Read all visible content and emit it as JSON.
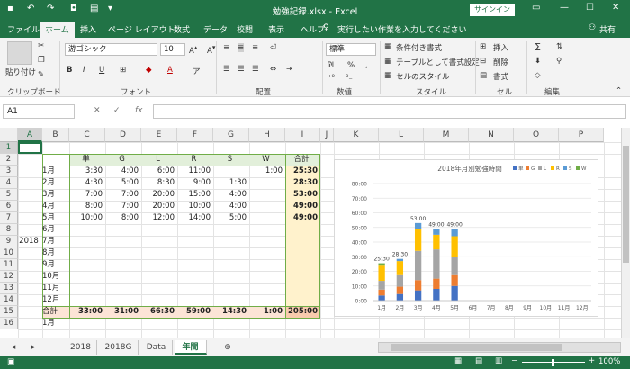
{
  "title": "勉強記録.xlsx - Excel",
  "signin": "サインイン",
  "tabs": [
    "ファイル",
    "ホーム",
    "挿入",
    "ページ レイアウト",
    "数式",
    "データ",
    "校閲",
    "表示",
    "ヘルプ"
  ],
  "tell_me": "実行したい作業を入力してください",
  "share": "共有",
  "ribbon": {
    "paste": "貼り付け",
    "font_name": "游ゴシック",
    "font_size": "10",
    "number_format": "標準",
    "cond_format": "条件付き書式",
    "table_format": "テーブルとして書式設定",
    "cell_styles": "セルのスタイル",
    "insert": "挿入",
    "delete": "削除",
    "format": "書式",
    "groups": [
      "クリップボード",
      "フォント",
      "配置",
      "数値",
      "スタイル",
      "セル",
      "編集"
    ]
  },
  "name_box": "A1",
  "columns": [
    "A",
    "B",
    "C",
    "D",
    "E",
    "F",
    "G",
    "H",
    "I",
    "J",
    "K",
    "L",
    "M",
    "N",
    "O",
    "P"
  ],
  "rows": [
    "1",
    "2",
    "3",
    "4",
    "5",
    "6",
    "7",
    "8",
    "9",
    "10",
    "11",
    "12",
    "13",
    "14",
    "15",
    "16"
  ],
  "table": {
    "headers": [
      "単",
      "G",
      "L",
      "R",
      "S",
      "W",
      "合計"
    ],
    "year": "2018",
    "months": [
      "1月",
      "2月",
      "3月",
      "4月",
      "5月",
      "6月",
      "7月",
      "8月",
      "9月",
      "10月",
      "11月",
      "12月"
    ],
    "data": [
      [
        "3:30",
        "4:00",
        "6:00",
        "11:00",
        "",
        "1:00",
        "25:30"
      ],
      [
        "4:30",
        "5:00",
        "8:30",
        "9:00",
        "1:30",
        "",
        "28:30"
      ],
      [
        "7:00",
        "7:00",
        "20:00",
        "15:00",
        "4:00",
        "",
        "53:00"
      ],
      [
        "8:00",
        "7:00",
        "20:00",
        "10:00",
        "4:00",
        "",
        "49:00"
      ],
      [
        "10:00",
        "8:00",
        "12:00",
        "14:00",
        "5:00",
        "",
        "49:00"
      ]
    ],
    "total_label": "合計",
    "totals": [
      "33:00",
      "31:00",
      "66:30",
      "59:00",
      "14:30",
      "1:00",
      "205:00"
    ],
    "row16": "1月"
  },
  "chart_data": {
    "type": "bar",
    "stacked": true,
    "title": "2018年月別勉強時間",
    "categories": [
      "1月",
      "2月",
      "3月",
      "4月",
      "5月",
      "6月",
      "7月",
      "8月",
      "9月",
      "10月",
      "11月",
      "12月"
    ],
    "series": [
      {
        "name": "単",
        "color": "#4472c4",
        "values": [
          3.5,
          4.5,
          7,
          8,
          10,
          0,
          0,
          0,
          0,
          0,
          0,
          0
        ]
      },
      {
        "name": "G",
        "color": "#ed7d31",
        "values": [
          4,
          5,
          7,
          7,
          8,
          0,
          0,
          0,
          0,
          0,
          0,
          0
        ]
      },
      {
        "name": "L",
        "color": "#a5a5a5",
        "values": [
          6,
          8.5,
          20,
          20,
          12,
          0,
          0,
          0,
          0,
          0,
          0,
          0
        ]
      },
      {
        "name": "R",
        "color": "#ffc000",
        "values": [
          11,
          9,
          15,
          10,
          14,
          0,
          0,
          0,
          0,
          0,
          0,
          0
        ]
      },
      {
        "name": "S",
        "color": "#5b9bd5",
        "values": [
          0,
          1.5,
          4,
          4,
          5,
          0,
          0,
          0,
          0,
          0,
          0,
          0
        ]
      },
      {
        "name": "W",
        "color": "#70ad47",
        "values": [
          1,
          0,
          0,
          0,
          0,
          0,
          0,
          0,
          0,
          0,
          0,
          0
        ]
      }
    ],
    "data_labels": [
      "25:30",
      "28:30",
      "53:00",
      "49:00",
      "49:00",
      "",
      "",
      "",
      "",
      "",
      "",
      ""
    ],
    "y_ticks": [
      "0:00",
      "10:00",
      "20:00",
      "30:00",
      "40:00",
      "50:00",
      "60:00",
      "70:00",
      "80:00"
    ],
    "ylim": [
      0,
      80
    ],
    "grid": true,
    "legend": "top-right"
  },
  "sheets": [
    "2018",
    "2018G",
    "Data",
    "年間"
  ],
  "active_sheet": "年間",
  "zoom": "100%"
}
